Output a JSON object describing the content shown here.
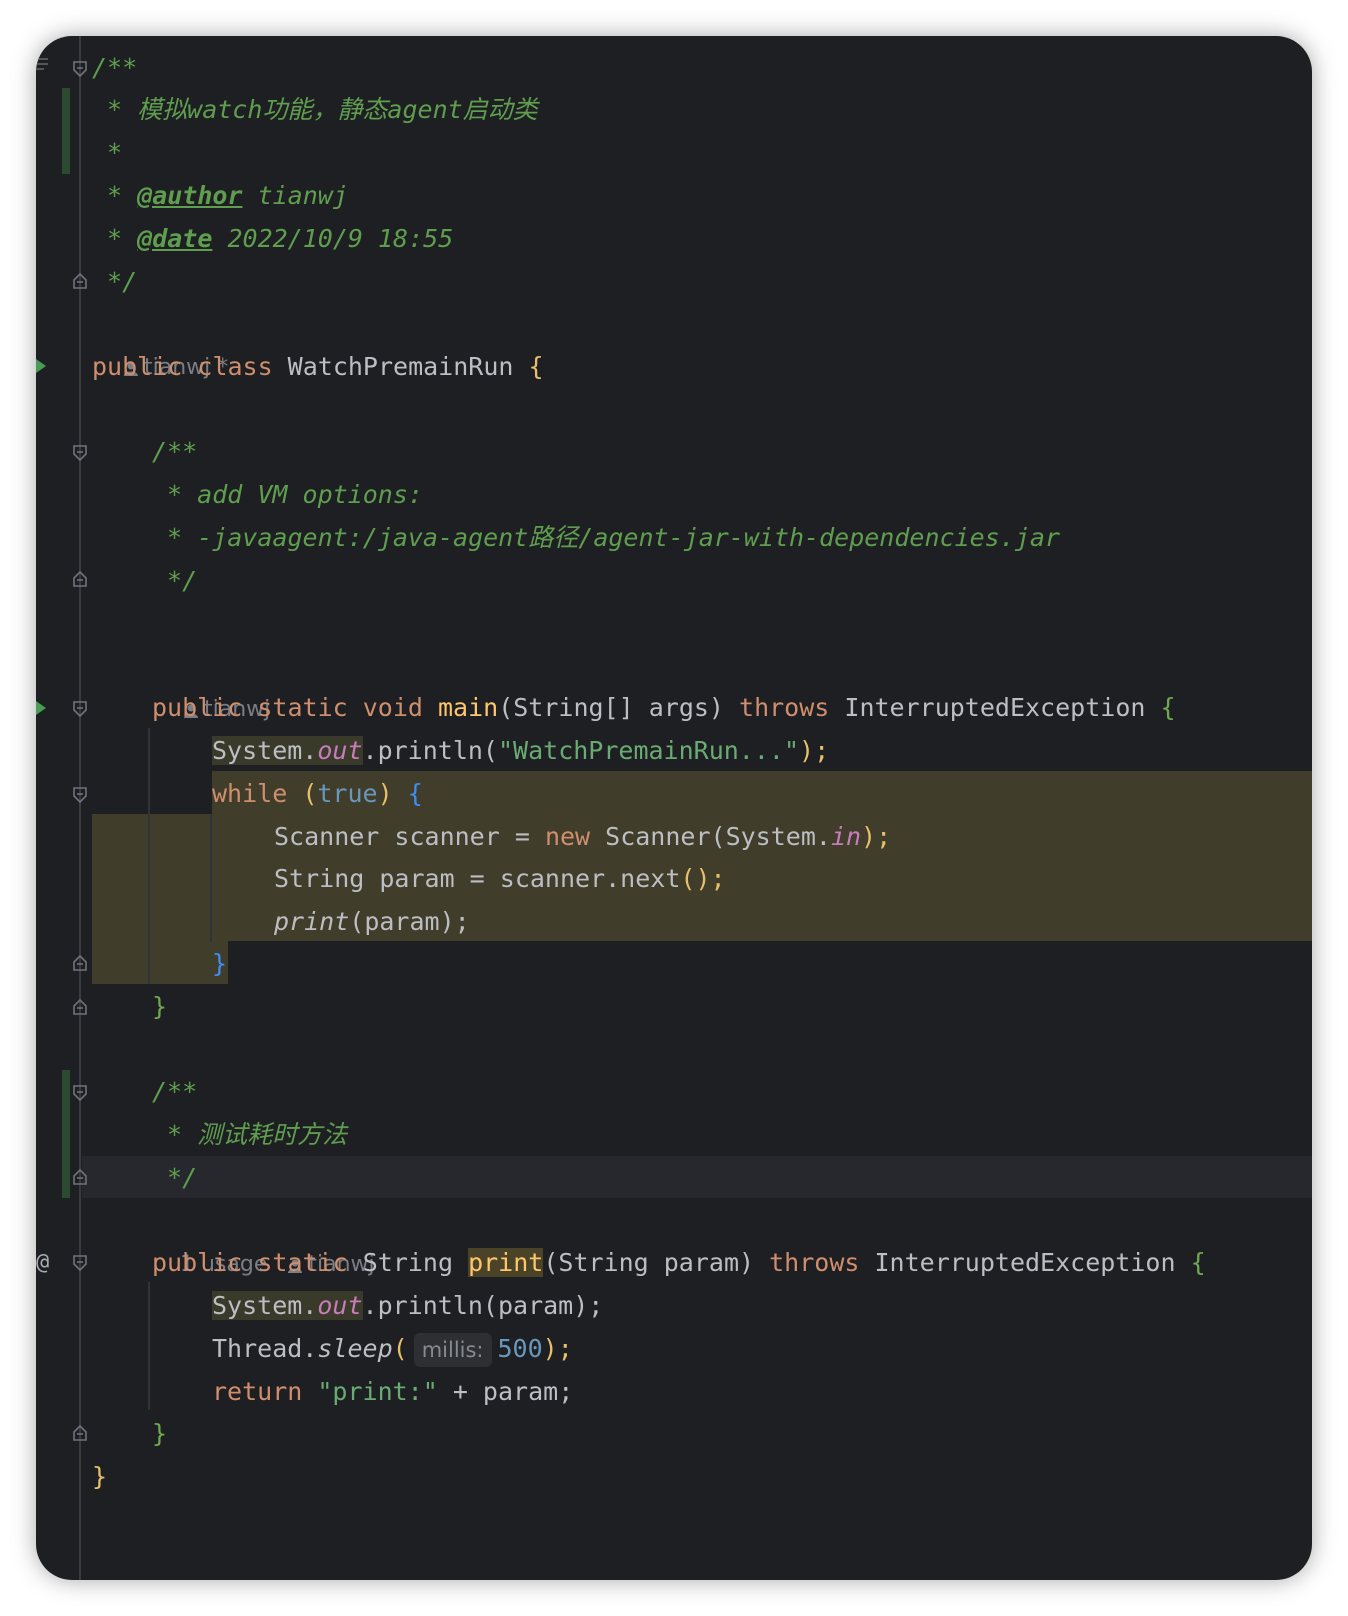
{
  "editor": {
    "author_hint": "tianwj *",
    "author_hint_plain": "tianwj",
    "usage_hint": "1 usage",
    "param_hint": "millis:",
    "lines": {
      "l1": "/**",
      "l2_star": " * ",
      "l2_text": "模拟watch功能，静态agent启动类",
      "l3": " *",
      "l4_star": " * ",
      "l4_tag": "@author",
      "l4_val": " tianwj",
      "l5_star": " * ",
      "l5_tag": "@date",
      "l5_val": " 2022/10/9 18:55",
      "l6": " */",
      "c1_kw": "public class ",
      "c1_name": "WatchPremainRun ",
      "c1_brace": "{",
      "d1": "/**",
      "d2": " * add VM options:",
      "d3": " * -javaagent:/java-agent路径/agent-jar-with-dependencies.jar",
      "d4": " */",
      "m1_kw": "public static void ",
      "m1_name": "main",
      "m1_sig": "(String[] args) ",
      "m1_throws": "throws ",
      "m1_exc": "InterruptedException ",
      "m1_brace": "{",
      "s1_a": "System.",
      "s1_out": "out",
      "s1_b": ".println(",
      "s1_str": "\"WatchPremainRun...\"",
      "s1_c": ");",
      "w1_kw": "while ",
      "w1_p": "(",
      "w1_true": "true",
      "w1_p2": ") ",
      "w1_brace": "{",
      "w2_a": "Scanner scanner = ",
      "w2_new": "new ",
      "w2_b": "Scanner(System.",
      "w2_in": "in",
      "w2_c": ");",
      "w3_a": "String param = scanner.next",
      "w3_b": "();",
      "w4_fn": "print",
      "w4_b": "(param);",
      "w5": "}",
      "m1_end": "}",
      "e1": "/**",
      "e2_star": " * ",
      "e2_text": "测试耗时方法",
      "e3": " */",
      "p1_kw": "public static ",
      "p1_type": "String ",
      "p1_name": "print",
      "p1_sig": "(String param) ",
      "p1_throws": "throws ",
      "p1_exc": "InterruptedException ",
      "p1_brace": "{",
      "p2_a": "System.",
      "p2_out": "out",
      "p2_b": ".println(param);",
      "p3_a": "Thread.",
      "p3_sleep": "sleep",
      "p3_p": "(",
      "p3_num": "500",
      "p3_c": ");",
      "p4_kw": "return ",
      "p4_str": "\"print:\"",
      "p4_b": " + param;",
      "p1_end": "}",
      "c1_end": "}"
    },
    "gutter_at": "@"
  }
}
